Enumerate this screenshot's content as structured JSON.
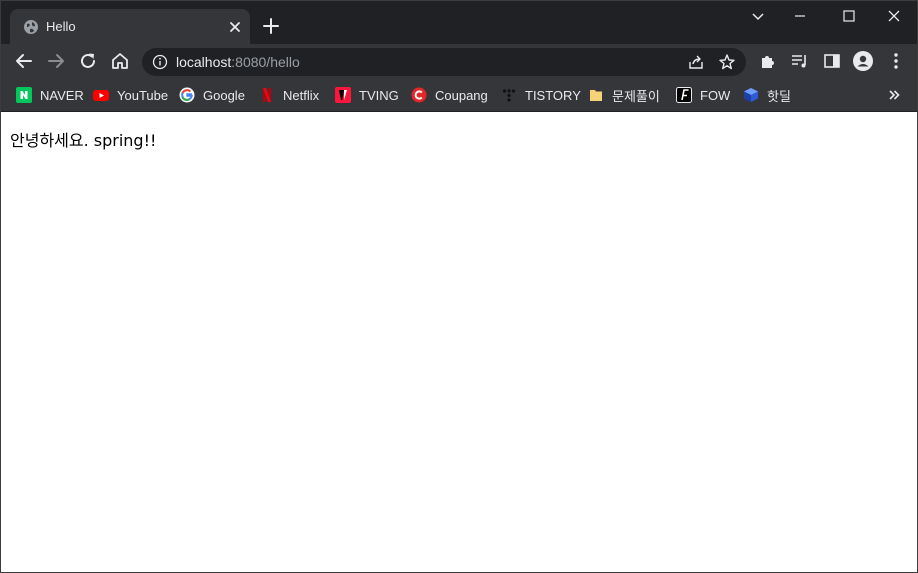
{
  "tab": {
    "title": "Hello",
    "favicon": "globe-icon"
  },
  "toolbar": {
    "url_host": "localhost",
    "url_rest": ":8080/hello"
  },
  "bookmarks": [
    {
      "label": "NAVER",
      "icon": "naver-icon",
      "color": "#03c75a"
    },
    {
      "label": "YouTube",
      "icon": "youtube-icon",
      "color": "#ff0000"
    },
    {
      "label": "Google",
      "icon": "google-icon",
      "color": "#4285f4"
    },
    {
      "label": "Netflix",
      "icon": "netflix-icon",
      "color": "#e50914"
    },
    {
      "label": "TVING",
      "icon": "tving-icon",
      "color": "#ff153c"
    },
    {
      "label": "Coupang",
      "icon": "coupang-icon",
      "color": "#e52528"
    },
    {
      "label": "TISTORY",
      "icon": "tistory-icon",
      "color": "#000000"
    },
    {
      "label": "문제풀이",
      "icon": "folder-icon",
      "color": "#f6d27a"
    },
    {
      "label": "FOW",
      "icon": "fow-icon",
      "color": "#ffffff"
    },
    {
      "label": "핫딜",
      "icon": "cube-icon",
      "color": "#2e5bd8"
    }
  ],
  "page": {
    "text": "안녕하세요. spring!!"
  }
}
